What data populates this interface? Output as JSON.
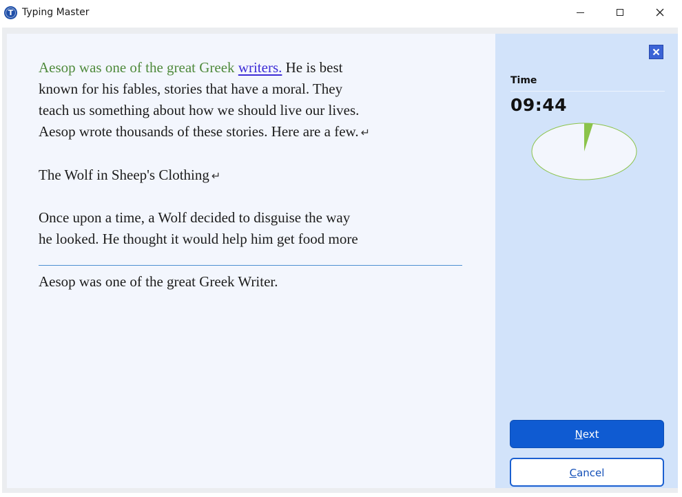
{
  "window": {
    "title": "Typing Master",
    "icon_letter": "T"
  },
  "text_panel": {
    "paragraph1": {
      "typed": "Aesop was one of the great Greek",
      "current_word": "writers.",
      "rest": "He is best\nknown for his fables, stories that have a moral. They\nteach us something about how we should live our lives.\nAesop wrote thousands of these stories. Here are a few."
    },
    "paragraph2": "The Wolf in Sheep's Clothing",
    "paragraph3": "Once upon a time, a Wolf decided to disguise the way\nhe looked. He thought it would help him get food more",
    "return_symbol": "↵",
    "input_text": "Aesop was one of the great Greek Writer."
  },
  "sidebar": {
    "time_label": "Time",
    "time_value": "09:44",
    "elapsed_fraction": 0.027,
    "next_label_key": "N",
    "next_label_rest": "ext",
    "cancel_label_key": "C",
    "cancel_label_rest": "ancel"
  },
  "colors": {
    "typed_text": "#4f8a3c",
    "current_word": "#3b2bd6",
    "pie_fill": "#f3f6fd",
    "pie_slice": "#8bc34a",
    "pie_stroke": "#8bc34a",
    "next_button": "#0f5bd2",
    "sidebar_bg": "#d2e3fa"
  },
  "icons": {
    "app": "typing-master-logo-icon",
    "minimize": "minimize-icon",
    "maximize": "maximize-icon",
    "close": "close-icon",
    "panel_close": "close-x-icon"
  }
}
